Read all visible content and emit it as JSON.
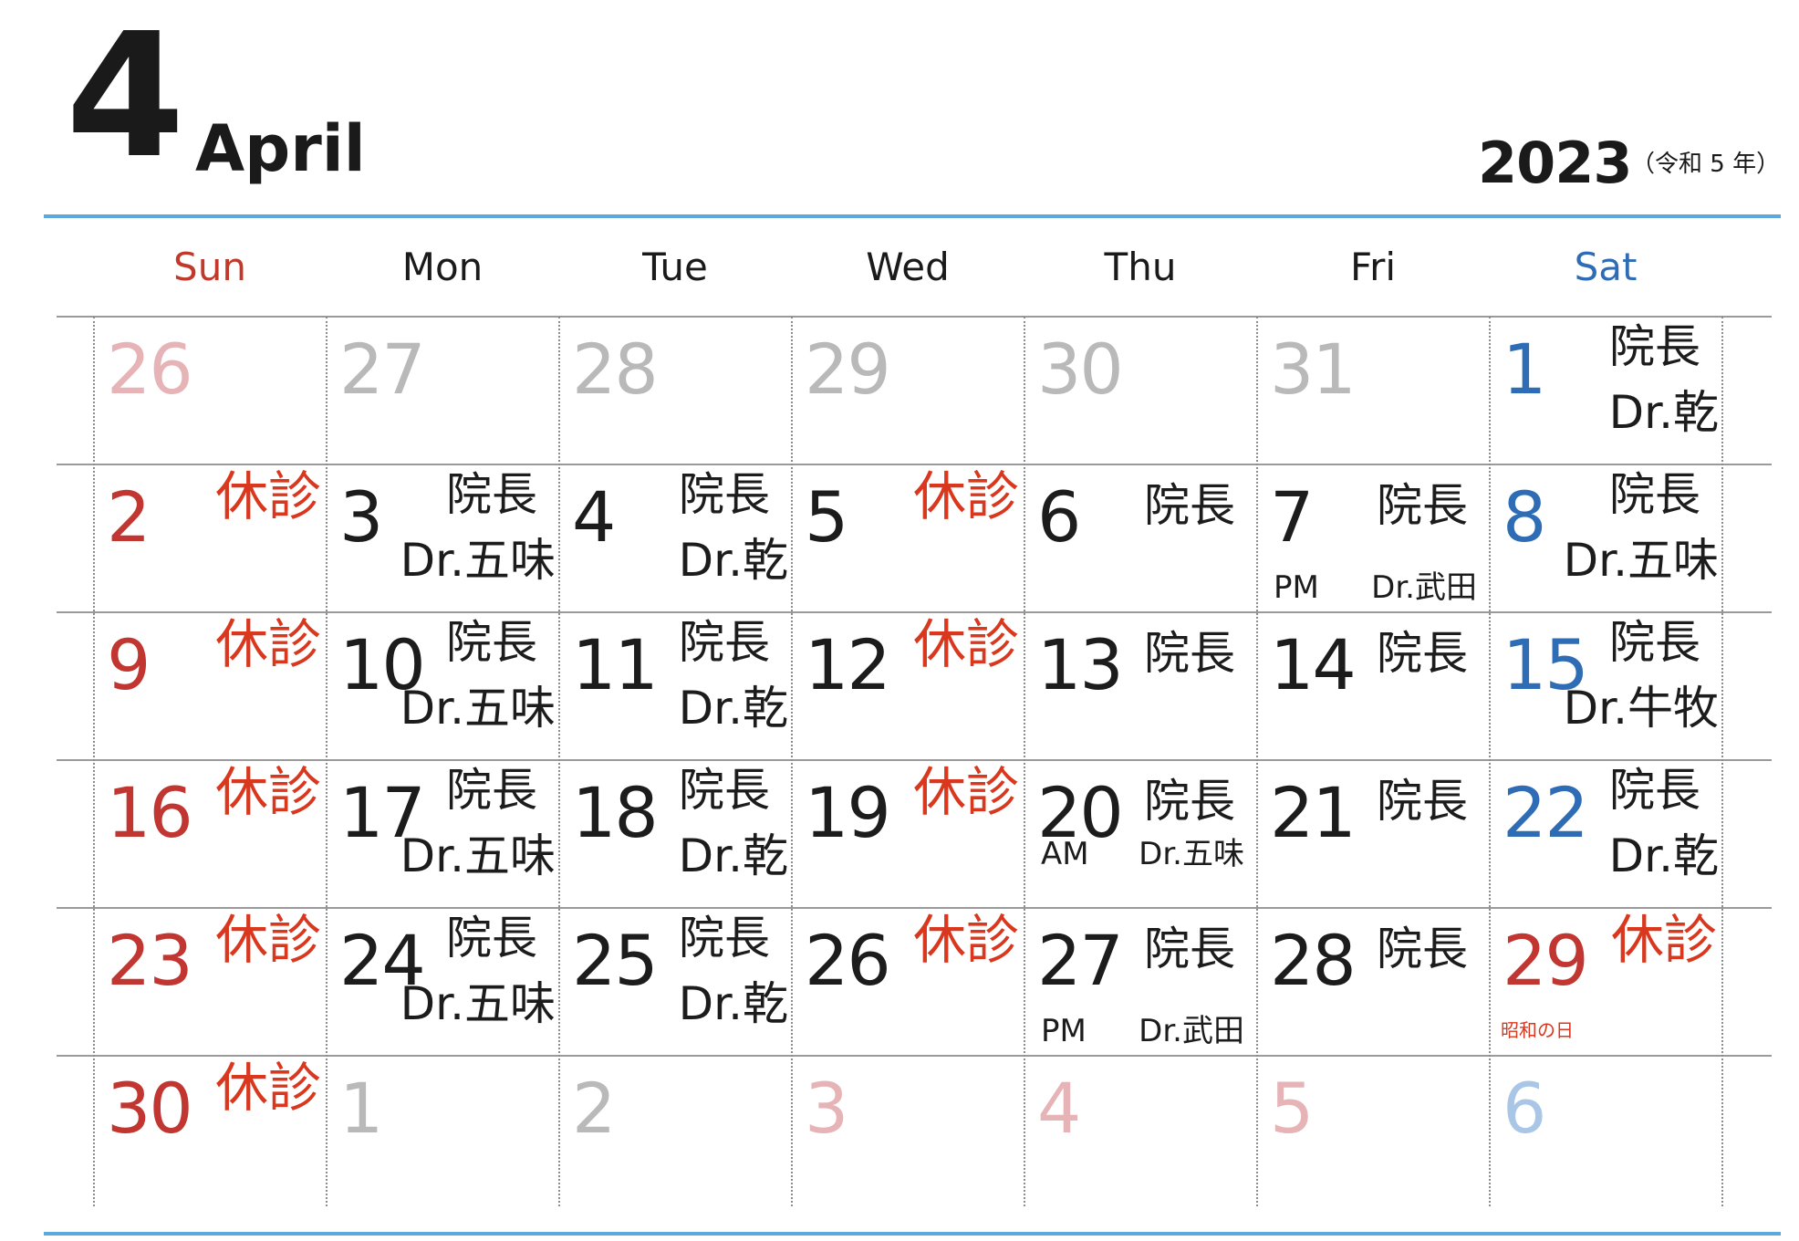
{
  "header": {
    "month_number": "4",
    "month_name": "April",
    "year": "2023",
    "era": "（令和 5 年）"
  },
  "weekdays": [
    "Sun",
    "Mon",
    "Tue",
    "Wed",
    "Thu",
    "Fri",
    "Sat"
  ],
  "labels": {
    "closed": "休診",
    "director": "院長"
  },
  "weeks": [
    [
      {
        "day": "26",
        "kind": "out-red"
      },
      {
        "day": "27",
        "kind": "out"
      },
      {
        "day": "28",
        "kind": "out"
      },
      {
        "day": "29",
        "kind": "out"
      },
      {
        "day": "30",
        "kind": "out"
      },
      {
        "day": "31",
        "kind": "out"
      },
      {
        "day": "1",
        "kind": "sat",
        "doctor1": "院長",
        "doctor2": "Dr.乾"
      }
    ],
    [
      {
        "day": "2",
        "kind": "sun",
        "off": "休診"
      },
      {
        "day": "3",
        "kind": "cur",
        "doctor1": "院長",
        "doctor2": "Dr.五味"
      },
      {
        "day": "4",
        "kind": "cur",
        "doctor1": "院長",
        "doctor2": "Dr.乾"
      },
      {
        "day": "5",
        "kind": "cur",
        "off": "休診"
      },
      {
        "day": "6",
        "kind": "cur",
        "doctor1": "院長"
      },
      {
        "day": "7",
        "kind": "cur",
        "doctor1": "院長",
        "ampm": "PM",
        "ampm_doctor": "Dr.武田"
      },
      {
        "day": "8",
        "kind": "sat",
        "doctor1": "院長",
        "doctor2": "Dr.五味"
      }
    ],
    [
      {
        "day": "9",
        "kind": "sun",
        "off": "休診"
      },
      {
        "day": "10",
        "kind": "cur",
        "doctor1": "院長",
        "doctor2": "Dr.五味"
      },
      {
        "day": "11",
        "kind": "cur",
        "doctor1": "院長",
        "doctor2": "Dr.乾"
      },
      {
        "day": "12",
        "kind": "cur",
        "off": "休診"
      },
      {
        "day": "13",
        "kind": "cur",
        "doctor1": "院長"
      },
      {
        "day": "14",
        "kind": "cur",
        "doctor1": "院長"
      },
      {
        "day": "15",
        "kind": "sat",
        "doctor1": "院長",
        "doctor2": "Dr.牛牧"
      }
    ],
    [
      {
        "day": "16",
        "kind": "sun",
        "off": "休診"
      },
      {
        "day": "17",
        "kind": "cur",
        "doctor1": "院長",
        "doctor2": "Dr.五味"
      },
      {
        "day": "18",
        "kind": "cur",
        "doctor1": "院長",
        "doctor2": "Dr.乾"
      },
      {
        "day": "19",
        "kind": "cur",
        "off": "休診"
      },
      {
        "day": "20",
        "kind": "cur",
        "doctor1": "院長",
        "ampm": "AM",
        "ampm_doctor": "Dr.五味",
        "ampm_high": true
      },
      {
        "day": "21",
        "kind": "cur",
        "doctor1": "院長"
      },
      {
        "day": "22",
        "kind": "sat",
        "doctor1": "院長",
        "doctor2": "Dr.乾"
      }
    ],
    [
      {
        "day": "23",
        "kind": "sun",
        "off": "休診"
      },
      {
        "day": "24",
        "kind": "cur",
        "doctor1": "院長",
        "doctor2": "Dr.五味"
      },
      {
        "day": "25",
        "kind": "cur",
        "doctor1": "院長",
        "doctor2": "Dr.乾"
      },
      {
        "day": "26",
        "kind": "cur",
        "off": "休診"
      },
      {
        "day": "27",
        "kind": "cur",
        "doctor1": "院長",
        "ampm": "PM",
        "ampm_doctor": "Dr.武田"
      },
      {
        "day": "28",
        "kind": "cur",
        "doctor1": "院長"
      },
      {
        "day": "29",
        "kind": "sun",
        "off": "休診",
        "holiday": "昭和の日"
      }
    ],
    [
      {
        "day": "30",
        "kind": "sun",
        "off": "休診"
      },
      {
        "day": "1",
        "kind": "out"
      },
      {
        "day": "2",
        "kind": "out"
      },
      {
        "day": "3",
        "kind": "out-red"
      },
      {
        "day": "4",
        "kind": "out-red"
      },
      {
        "day": "5",
        "kind": "out-red"
      },
      {
        "day": "6",
        "kind": "out-blue"
      }
    ]
  ]
}
